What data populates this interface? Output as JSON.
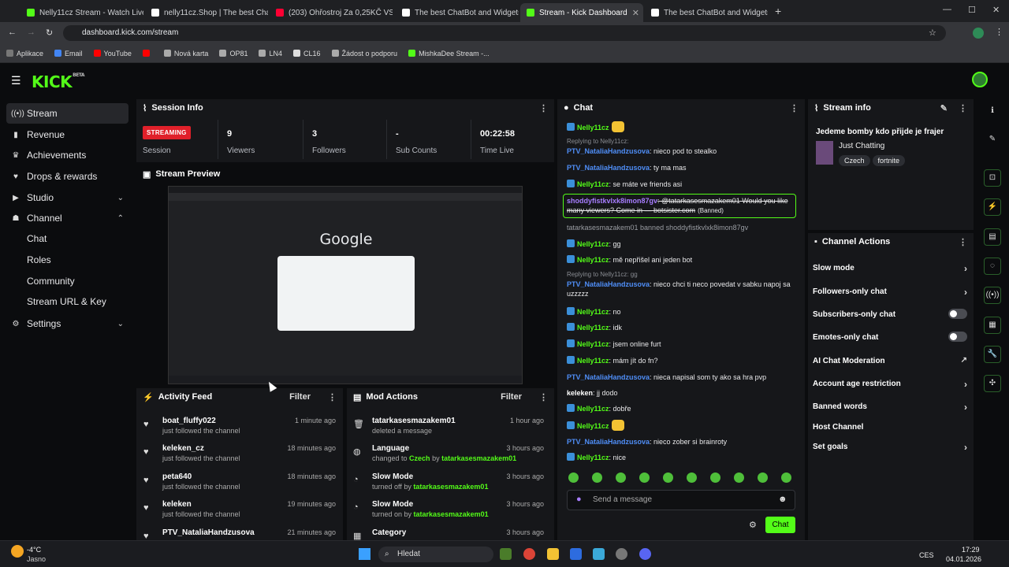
{
  "browser": {
    "tabs": [
      {
        "title": "Nelly11cz Stream - Watch Live o",
        "color": "#53fc18"
      },
      {
        "title": "nelly11cz.Shop | The best Chat",
        "color": "#ffffff"
      },
      {
        "title": "(203) Ohřostroj Za 0,25KČ VS 5",
        "color": "#ff0033"
      },
      {
        "title": "The best ChatBot and Widgets",
        "color": "#ffffff"
      },
      {
        "title": "Stream - Kick Dashboard",
        "color": "#53fc18"
      },
      {
        "title": "The best ChatBot and Widgets",
        "color": "#ffffff"
      }
    ],
    "url": "dashboard.kick.com/stream",
    "bookmarks": [
      "Aplikace",
      "Email",
      "YouTube",
      "",
      "Nová karta",
      "OP81",
      "LN4",
      "CL16",
      "Žádost o podporu",
      "MishkaDee Stream -..."
    ]
  },
  "brand": {
    "logo": "KICK",
    "beta": "BETA",
    "accent": "#53fc18"
  },
  "sidebar": {
    "items": [
      {
        "label": "Stream",
        "icon": "stream-icon"
      },
      {
        "label": "Revenue",
        "icon": "revenue-icon"
      },
      {
        "label": "Achievements",
        "icon": "trophy-icon"
      },
      {
        "label": "Drops & rewards",
        "icon": "gift-icon"
      },
      {
        "label": "Studio",
        "icon": "studio-icon"
      },
      {
        "label": "Channel",
        "icon": "channel-icon"
      },
      {
        "label": "Settings",
        "icon": "gear-icon"
      }
    ],
    "channel_sub": [
      "Chat",
      "Roles",
      "Community",
      "Stream URL & Key"
    ]
  },
  "session": {
    "title": "Session Info",
    "status": "STREAMING",
    "status_label": "Session",
    "viewers": "9",
    "viewers_label": "Viewers",
    "followers": "3",
    "followers_label": "Followers",
    "subs": "-",
    "subs_label": "Sub Counts",
    "time": "00:22:58",
    "time_label": "Time Live"
  },
  "preview": {
    "title": "Stream Preview",
    "google": "Google"
  },
  "activity": {
    "title": "Activity Feed",
    "filter": "Filter",
    "items": [
      {
        "name": "boat_fluffy022",
        "desc": "just followed the channel",
        "time": "1 minute ago"
      },
      {
        "name": "keleken_cz",
        "desc": "just followed the channel",
        "time": "18 minutes ago"
      },
      {
        "name": "peta640",
        "desc": "just followed the channel",
        "time": "18 minutes ago"
      },
      {
        "name": "keleken",
        "desc": "just followed the channel",
        "time": "19 minutes ago"
      },
      {
        "name": "PTV_NataliaHandzusova",
        "desc": "",
        "time": "21 minutes ago"
      }
    ]
  },
  "mod": {
    "title": "Mod Actions",
    "filter": "Filter",
    "items": [
      {
        "name": "tatarkasesmazakem01",
        "pre": "deleted a message",
        "mid": "",
        "by": "",
        "time": "1 hour ago"
      },
      {
        "name": "Language",
        "pre": "changed to ",
        "mid": "Czech",
        "by": "tatarkasesmazakem01",
        "time": "3 hours ago"
      },
      {
        "name": "Slow Mode",
        "pre": "turned off by ",
        "mid": "",
        "by": "tatarkasesmazakem01",
        "time": "3 hours ago"
      },
      {
        "name": "Slow Mode",
        "pre": "turned on by ",
        "mid": "",
        "by": "tatarkasesmazakem01",
        "time": "3 hours ago"
      },
      {
        "name": "Category",
        "pre": "",
        "mid": "",
        "by": "",
        "time": "3 hours ago"
      }
    ],
    "by_word": " by "
  },
  "chat": {
    "title": "Chat",
    "placeholder": "Send a message",
    "send": "Chat",
    "messages": [
      {
        "user": "Nelly11cz",
        "cls": "u-g",
        "badge": true,
        "text": "",
        "emote": true
      },
      {
        "reply": "Replying to Nelly11cz:",
        "user": "PTV_NataliaHandzusova",
        "cls": "u-b",
        "text": ": nieco pod to stealko"
      },
      {
        "user": "PTV_NataliaHandzusova",
        "cls": "u-b",
        "text": ": ty ma mas"
      },
      {
        "user": "Nelly11cz",
        "cls": "u-g",
        "badge": true,
        "text": ": se máte ve friends asi"
      },
      {
        "user": "shoddyfistkvlxk8imon87gv",
        "cls": "u-p",
        "text": ": @tatarkasesmazakem01 Would you like many viewers? Come in — botsister.com",
        "banned": "(Banned)"
      },
      {
        "system": "tatarkasesmazakem01 banned shoddyfistkvlxk8imon87gv"
      },
      {
        "user": "Nelly11cz",
        "cls": "u-g",
        "badge": true,
        "text": ": gg"
      },
      {
        "user": "Nelly11cz",
        "cls": "u-g",
        "badge": true,
        "text": ": mě nepřišel ani jeden bot"
      },
      {
        "reply": "Replying to Nelly11cz: gg",
        "user": "PTV_NataliaHandzusova",
        "cls": "u-b",
        "text": ": nieco chci ti neco povedat v sabku napoj sa uzzzzz"
      },
      {
        "user": "Nelly11cz",
        "cls": "u-g",
        "badge": true,
        "text": ": no"
      },
      {
        "user": "Nelly11cz",
        "cls": "u-g",
        "badge": true,
        "text": ": idk"
      },
      {
        "user": "Nelly11cz",
        "cls": "u-g",
        "badge": true,
        "text": ": jsem online furt"
      },
      {
        "user": "Nelly11cz",
        "cls": "u-g",
        "badge": true,
        "text": ": mám jít do fn?"
      },
      {
        "user": "PTV_NataliaHandzusova",
        "cls": "u-b",
        "text": ": nieca napisal som ty ako sa hra pvp"
      },
      {
        "user": "keleken",
        "cls": "u-w",
        "text": ": jj dodo"
      },
      {
        "user": "Nelly11cz",
        "cls": "u-g",
        "badge": true,
        "text": ": dobře"
      },
      {
        "user": "Nelly11cz",
        "cls": "u-g",
        "badge": true,
        "text": "",
        "emote": true
      },
      {
        "user": "PTV_NataliaHandzusova",
        "cls": "u-b",
        "text": ": nieco zober si brainroty"
      },
      {
        "user": "Nelly11cz",
        "cls": "u-g",
        "badge": true,
        "text": ": nice"
      }
    ]
  },
  "stream_info": {
    "title": "Stream info",
    "stream_title": "Jedeme bomby kdo přijde je frajer",
    "category": "Just Chatting",
    "tags": [
      "Czech",
      "fortnite"
    ]
  },
  "channel_actions": {
    "title": "Channel Actions",
    "items": [
      {
        "label": "Slow mode",
        "kind": "arrow"
      },
      {
        "label": "Followers-only chat",
        "kind": "arrow"
      },
      {
        "label": "Subscribers-only chat",
        "kind": "toggle"
      },
      {
        "label": "Emotes-only chat",
        "kind": "toggle"
      },
      {
        "label": "AI Chat Moderation",
        "kind": "ext"
      },
      {
        "label": "Account age restriction",
        "kind": "arrow"
      },
      {
        "label": "Banned words",
        "kind": "arrow"
      },
      {
        "label": "Host Channel",
        "kind": "none"
      },
      {
        "label": "Set goals",
        "kind": "arrow"
      }
    ]
  },
  "taskbar": {
    "weather_temp": "-4°C",
    "weather_desc": "Jasno",
    "search": "Hledat",
    "lang": "CES",
    "time": "17:29",
    "date": "04.01.2026"
  }
}
